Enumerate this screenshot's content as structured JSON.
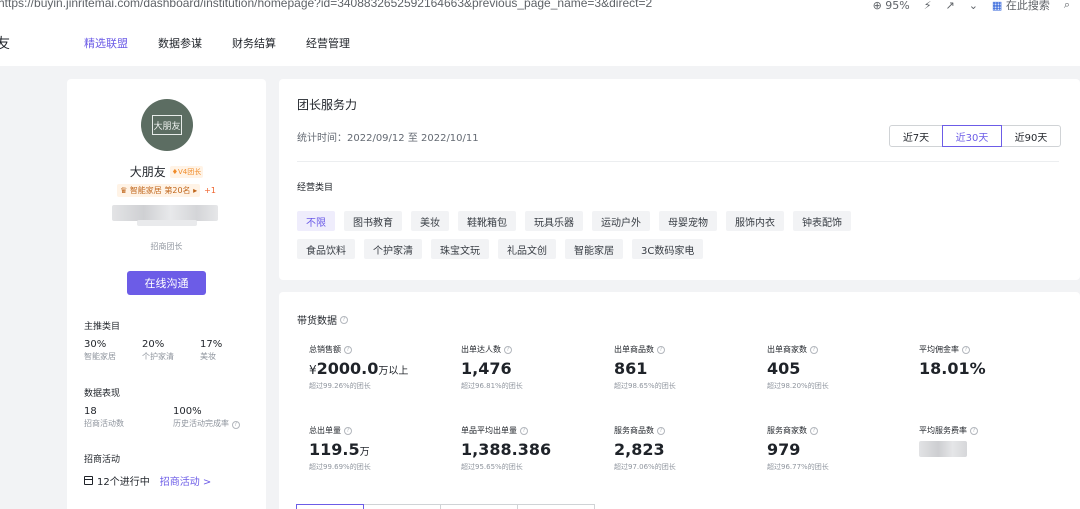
{
  "browser": {
    "url": "https://buyin.jinritemai.com/dashboard/institution/homepage?id=3408832652592164663&previous_page_name=3&direct=2",
    "zoom": "95%",
    "search_label": "在此搜索"
  },
  "topnav": {
    "brand": "友",
    "items": [
      "精选联盟",
      "数据参谋",
      "财务结算",
      "经营管理"
    ],
    "active_index": 0
  },
  "profile": {
    "avatar_text": "大朋友",
    "name": "大朋友",
    "level_badge": "V4团长",
    "rank_text": "智能家居 第20名",
    "rank_extra": "+1",
    "role": "招商团长",
    "contact_button": "在线沟通",
    "main_category": {
      "title": "主推类目",
      "items": [
        {
          "value": "30%",
          "label": "智能家居"
        },
        {
          "value": "20%",
          "label": "个护家清"
        },
        {
          "value": "17%",
          "label": "美妆"
        }
      ]
    },
    "performance": {
      "title": "数据表现",
      "items": [
        {
          "value": "18",
          "label": "招商活动数"
        },
        {
          "value": "100%",
          "label": "历史活动完成率"
        }
      ]
    },
    "activity": {
      "title": "招商活动",
      "count_text": "12个进行中",
      "link": "招商活动",
      "link_arrow": ">"
    }
  },
  "service": {
    "title": "团长服务力",
    "time_label": "统计时间：2022/09/12 至 2022/10/11",
    "ranges": [
      "近7天",
      "近30天",
      "近90天"
    ],
    "active_range": 1,
    "category_title": "经营类目",
    "categories": [
      "不限",
      "图书教育",
      "美妆",
      "鞋靴箱包",
      "玩具乐器",
      "运动户外",
      "母婴宠物",
      "服饰内衣",
      "钟表配饰",
      "食品饮料",
      "个护家清",
      "珠宝文玩",
      "礼品文创",
      "智能家居",
      "3C数码家电"
    ],
    "active_category": 0
  },
  "sales": {
    "title": "带货数据",
    "metrics": [
      {
        "label": "总销售额",
        "prefix": "¥",
        "value": "2000.0",
        "unit": "万以上",
        "sub": "超过99.26%的团长"
      },
      {
        "label": "出单达人数",
        "prefix": "",
        "value": "1,476",
        "unit": "",
        "sub": "超过96.81%的团长"
      },
      {
        "label": "出单商品数",
        "prefix": "",
        "value": "861",
        "unit": "",
        "sub": "超过98.65%的团长"
      },
      {
        "label": "出单商家数",
        "prefix": "",
        "value": "405",
        "unit": "",
        "sub": "超过98.20%的团长"
      },
      {
        "label": "平均佣金率",
        "prefix": "",
        "value": "18.01%",
        "unit": "",
        "sub": ""
      },
      {
        "label": "总出单量",
        "prefix": "",
        "value": "119.5",
        "unit": "万",
        "sub": "超过99.69%的团长"
      },
      {
        "label": "单品平均出单量",
        "prefix": "",
        "value": "1,388.386",
        "unit": "",
        "sub": "超过95.65%的团长"
      },
      {
        "label": "服务商品数",
        "prefix": "",
        "value": "2,823",
        "unit": "",
        "sub": "超过97.06%的团长"
      },
      {
        "label": "服务商家数",
        "prefix": "",
        "value": "979",
        "unit": "",
        "sub": "超过96.77%的团长"
      },
      {
        "label": "平均服务费率",
        "prefix": "",
        "value": "",
        "unit": "",
        "sub": ""
      }
    ]
  },
  "colors": {
    "accent": "#6c5ce7",
    "page_bg": "#f2f3f5",
    "text": "#1f2329",
    "muted": "#8f959e"
  }
}
